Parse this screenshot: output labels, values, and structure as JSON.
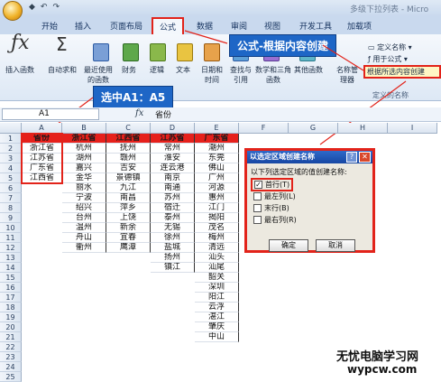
{
  "window": {
    "title": "多级下拉列表 - Micro",
    "qat": [
      "◆",
      "↶",
      "↷"
    ]
  },
  "tabs": [
    "开始",
    "插入",
    "页面布局",
    "公式",
    "数据",
    "审阅",
    "视图",
    "开发工具",
    "加载项"
  ],
  "active_tab": "公式",
  "ribbon": {
    "insert_function": "插入函数",
    "autosum": "自动求和",
    "recent": "最近使用的函数",
    "financial": "财务",
    "logical": "逻辑",
    "text": "文本",
    "datetime": "日期和时间",
    "lookup": "查找与引用",
    "math": "数学和三角函数",
    "more": "其他函数",
    "name_manager": "名称管理器",
    "define_name": "定义名称",
    "use_in_formula": "用于公式",
    "create_from_selection": "根据所选内容创建",
    "group_defined_names": "定义的名称",
    "icons": [
      "fx-icon",
      "sigma-icon",
      "recent-book-icon",
      "financial-book-icon",
      "logical-book-icon",
      "text-book-icon",
      "datetime-book-icon",
      "lookup-book-icon",
      "math-book-icon",
      "more-book-icon"
    ]
  },
  "callouts": {
    "formula_callout": "公式-根据内容创建",
    "select_callout": "选中A1：A5"
  },
  "formula_bar": {
    "name_box": "A1",
    "fx": "fx",
    "value": "省份"
  },
  "columns": [
    "A",
    "B",
    "C",
    "D",
    "E",
    "F",
    "G",
    "H",
    "I"
  ],
  "rows": [
    "1",
    "2",
    "3",
    "4",
    "5",
    "6",
    "7",
    "8",
    "9",
    "10",
    "11",
    "12",
    "13",
    "14",
    "15",
    "16",
    "17",
    "18",
    "19",
    "20",
    "21",
    "22",
    "23",
    "24",
    "25"
  ],
  "sheet": {
    "A": [
      "省份",
      "浙江省",
      "江苏省",
      "广东省",
      "江西省"
    ],
    "B": [
      "浙江省",
      "杭州",
      "湖州",
      "嘉兴",
      "金华",
      "丽水",
      "宁波",
      "绍兴",
      "台州",
      "温州",
      "舟山",
      "衢州"
    ],
    "C": [
      "江西省",
      "抚州",
      "赣州",
      "吉安",
      "景德镇",
      "九江",
      "南昌",
      "萍乡",
      "上饶",
      "新余",
      "宜春",
      "鹰潭"
    ],
    "D": [
      "江苏省",
      "常州",
      "淮安",
      "连云港",
      "南京",
      "南通",
      "苏州",
      "宿迁",
      "泰州",
      "无锡",
      "徐州",
      "盐城",
      "扬州",
      "镇江"
    ],
    "E": [
      "广东省",
      "潮州",
      "东莞",
      "佛山",
      "广州",
      "河源",
      "惠州",
      "江门",
      "揭阳",
      "茂名",
      "梅州",
      "清远",
      "汕头",
      "汕尾",
      "韶关",
      "深圳",
      "阳江",
      "云浮",
      "湛江",
      "肇庆",
      "中山"
    ]
  },
  "dialog": {
    "title": "以选定区域创建名称",
    "help": "?",
    "close": "✕",
    "prompt": "以下列选定区域的值创建名称:",
    "options": [
      {
        "label": "首行(T)",
        "checked": true
      },
      {
        "label": "最左列(L)",
        "checked": false
      },
      {
        "label": "末行(B)",
        "checked": false
      },
      {
        "label": "最右列(R)",
        "checked": false
      }
    ],
    "ok": "确定",
    "cancel": "取消"
  },
  "watermark": {
    "line1": "无忧电脑学习网",
    "line2": "wypcw.com"
  },
  "colors": {
    "accent_red": "#e2231a",
    "callout_blue": "#1e66c6",
    "header_red": "#e6201b"
  }
}
